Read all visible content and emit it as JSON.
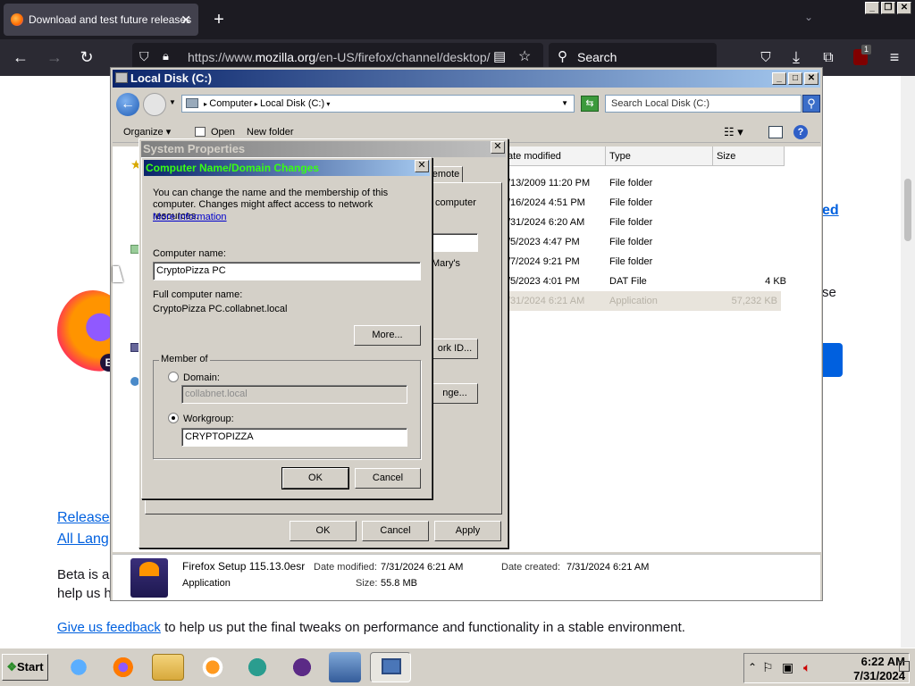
{
  "browser": {
    "tab_title": "Download and test future releases",
    "tab_close": "✕",
    "new_tab": "+",
    "url_prefix": "https://www.",
    "url_domain": "mozilla.org",
    "url_path": "/en-US/firefox/channel/desktop/",
    "search_placeholder": "Search",
    "extension_badge": "1"
  },
  "page": {
    "heading_fragment": "ed",
    "side_text_fragment": "se",
    "release_link_fragment": "Release",
    "all_lang_fragment": "All Lang",
    "beta_text_1": "Beta is a",
    "beta_text_2": "help us h",
    "feedback_link": "Give us feedback",
    "feedback_text": " to help us put the final tweaks on performance and functionality in a stable environment."
  },
  "explorer": {
    "title": "Local Disk (C:)",
    "breadcrumb": [
      "Computer",
      "Local Disk (C:)"
    ],
    "search_placeholder": "Search Local Disk (C:)",
    "toolbar": {
      "organize": "Organize",
      "open": "Open",
      "new_folder": "New folder"
    },
    "columns": [
      "ate modified",
      "Type",
      "Size"
    ],
    "rows": [
      {
        "date": "/13/2009 11:20 PM",
        "type": "File folder",
        "size": ""
      },
      {
        "date": "/16/2024 4:51 PM",
        "type": "File folder",
        "size": ""
      },
      {
        "date": "/31/2024 6:20 AM",
        "type": "File folder",
        "size": ""
      },
      {
        "date": "/5/2023 4:47 PM",
        "type": "File folder",
        "size": ""
      },
      {
        "date": "/7/2024 9:21 PM",
        "type": "File folder",
        "size": ""
      },
      {
        "date": "/5/2023 4:01 PM",
        "type": "DAT File",
        "size": "4 KB"
      },
      {
        "date": "/31/2024 6:21 AM",
        "type": "Application",
        "size": "57,232 KB"
      }
    ],
    "details": {
      "name": "Firefox Setup 115.13.0esr",
      "kind": "Application",
      "date_modified_label": "Date modified:",
      "date_modified": "7/31/2024 6:21 AM",
      "date_created_label": "Date created:",
      "date_created": "7/31/2024 6:21 AM",
      "size_label": "Size:",
      "size": "55.8 MB"
    }
  },
  "system_properties": {
    "title": "System Properties",
    "tab_remote": "emote",
    "text_computer": "computer",
    "text_marys": "Mary's",
    "network_id_btn": "ork ID...",
    "change_btn": "nge...",
    "ok": "OK",
    "cancel": "Cancel",
    "apply": "Apply"
  },
  "name_changes": {
    "title": "Computer Name/Domain Changes",
    "description": "You can change the name and the membership of this computer. Changes might affect access to network resources.",
    "more_info_link": "More information",
    "computer_name_label": "Computer name:",
    "computer_name_value": "CryptoPizza PC",
    "full_name_label": "Full computer name:",
    "full_name_value": "CryptoPizza PC.collabnet.local",
    "more_btn": "More...",
    "member_of_label": "Member of",
    "domain_label": "Domain:",
    "domain_value": "collabnet.local",
    "workgroup_label": "Workgroup:",
    "workgroup_value": "CRYPTOPIZZA",
    "ok": "OK",
    "cancel": "Cancel"
  },
  "taskbar": {
    "start": "Start",
    "time": "6:22 AM",
    "date": "7/31/2024"
  }
}
